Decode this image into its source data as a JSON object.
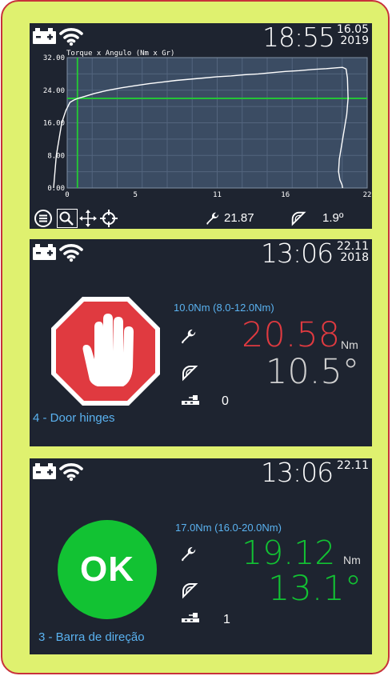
{
  "colors": {
    "frame_bg": "#dff16f",
    "frame_border": "#c8323b",
    "screen_bg": "#1e2430",
    "plot_bg": "#3b4c63",
    "crosshair": "#22cc33",
    "nok_red": "#e03a40",
    "ok_green": "#12c233",
    "target_blue": "#5ab2f0",
    "value_grey": "#d0d0d0"
  },
  "screen1": {
    "time": "18:55",
    "date_day": "16.05",
    "date_year": "2019",
    "icons": [
      "battery-icon",
      "wifi-icon",
      "menu-icon",
      "zoom-icon",
      "pan-icon",
      "target-icon",
      "wrench-icon",
      "protractor-icon"
    ],
    "torque_readout": "21.87",
    "angle_readout": "1.9º"
  },
  "chart_data": {
    "type": "line",
    "title": "Torque x Angulo (Nm x Gr)",
    "xlabel": "",
    "ylabel": "",
    "xlim": [
      0,
      22
    ],
    "ylim": [
      0,
      32
    ],
    "x_ticks": [
      "0",
      "5",
      "11",
      "16",
      "22"
    ],
    "y_ticks": [
      "0.00",
      "8.00",
      "16.00",
      "24.00",
      "32.00"
    ],
    "grid": true,
    "crosshair": {
      "x": 0.75,
      "y": 22
    },
    "series": [
      {
        "x": [
          -1.0,
          -0.9,
          -0.8,
          -0.6,
          -0.4,
          -0.1,
          0.2,
          0.5,
          0.8,
          1.2,
          2,
          3,
          4,
          5,
          6,
          7,
          8,
          9,
          10,
          11,
          12,
          13,
          14,
          15,
          16,
          17,
          18,
          19,
          19.8,
          20.2,
          20.45,
          20.55,
          20.6,
          20.5,
          20.3,
          20.1,
          19.95,
          19.9,
          20.0,
          20.15,
          20.2
        ],
        "y": [
          0,
          4,
          8,
          12,
          16,
          19,
          21,
          21.6,
          22,
          22.4,
          23.2,
          24.0,
          24.6,
          25.1,
          25.6,
          26.0,
          26.4,
          26.7,
          27.0,
          27.3,
          27.5,
          27.8,
          28.0,
          28.3,
          28.6,
          28.8,
          29.1,
          29.3,
          29.5,
          29.6,
          29.2,
          27,
          22,
          18,
          14,
          10,
          7,
          4,
          2,
          0.8,
          0
        ]
      }
    ]
  },
  "screen2": {
    "time": "13:06",
    "date_day": "22.11",
    "date_year": "2018",
    "status_icon": "stop-hand-icon",
    "target": "10.0Nm (8.0-12.0Nm)",
    "torque_value": "20.58",
    "torque_unit": "Nm",
    "torque_color": "#e03a40",
    "angle_value": "10.5°",
    "count": "0",
    "job_name": "4 - Door hinges"
  },
  "screen3": {
    "time": "13:06",
    "date_day": "22.11",
    "status_text": "OK",
    "target": "17.0Nm (16.0-20.0Nm)",
    "torque_value": "19.12",
    "torque_unit": "Nm",
    "angle_value": "13.1°",
    "count": "1",
    "job_name": "3 - Barra de direção"
  }
}
